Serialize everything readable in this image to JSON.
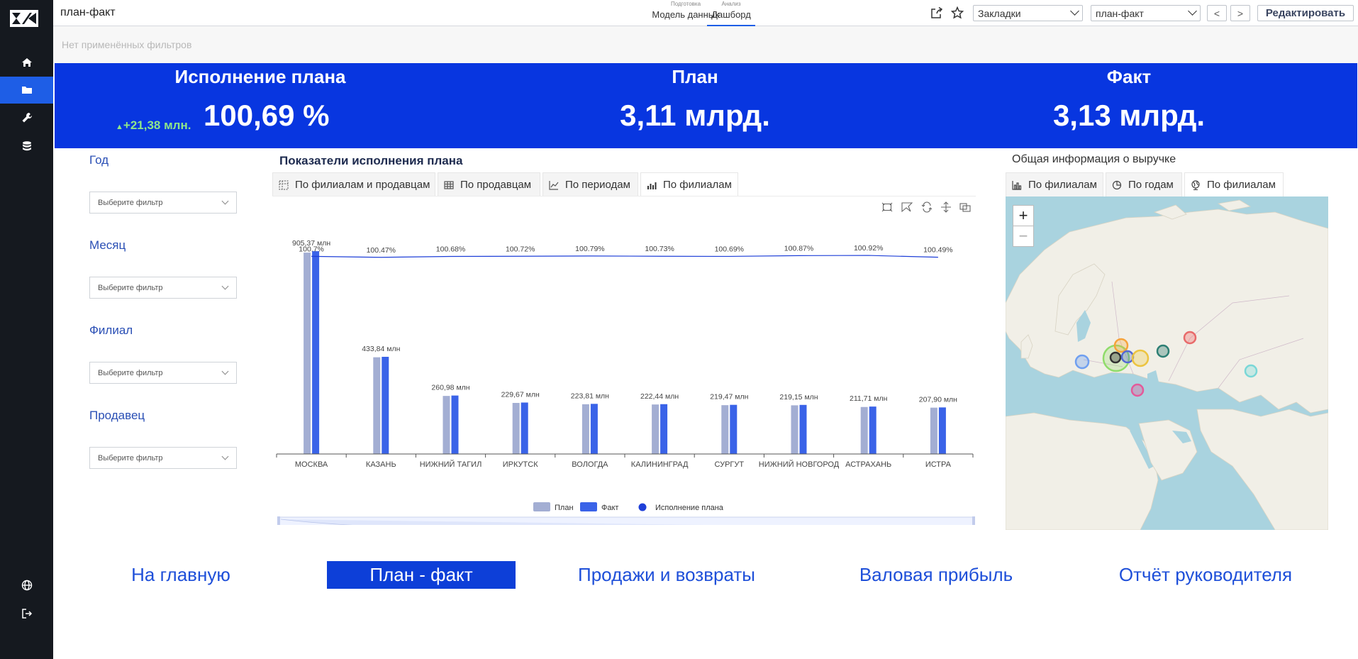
{
  "app": {
    "page_title": "план-факт"
  },
  "mode_tabs": [
    {
      "small": "Подготовка",
      "label": "Модель данных"
    },
    {
      "small": "Анализ",
      "label": "Дашборд"
    }
  ],
  "toolbar": {
    "bookmarks_value": "Закладки",
    "report_value": "план-факт",
    "prev_label": "<",
    "next_label": ">",
    "edit_label": "Редактировать"
  },
  "filter_bar": {
    "text": "Нет применённых фильтров"
  },
  "kpi": {
    "execution": {
      "title": "Исполнение плана",
      "delta": "+21,38 млн.",
      "value": "100,69 %"
    },
    "plan": {
      "title": "План",
      "value": "3,11 млрд."
    },
    "fact": {
      "title": "Факт",
      "value": "3,13 млрд."
    }
  },
  "filters": [
    {
      "label": "Год",
      "placeholder": "Выберите фильтр"
    },
    {
      "label": "Месяц",
      "placeholder": "Выберите фильтр"
    },
    {
      "label": "Филиал",
      "placeholder": "Выберите фильтр"
    },
    {
      "label": "Продавец",
      "placeholder": "Выберите фильтр"
    }
  ],
  "chart_panel": {
    "title": "Показатели исполнения плана",
    "tabs": [
      "По филиалам и продавцам",
      "По продавцам",
      "По периодам",
      "По филиалам"
    ],
    "active_tab": 3
  },
  "chart_data": {
    "type": "bar",
    "categories": [
      "МОСКВА",
      "КАЗАНЬ",
      "НИЖНИЙ ТАГИЛ",
      "ИРКУТСК",
      "ВОЛОГДА",
      "КАЛИНИНГРАД",
      "СУРГУТ",
      "НИЖНИЙ НОВГОРОД",
      "АСТРАХАНЬ",
      "ИСТРА"
    ],
    "series": [
      {
        "name": "План",
        "values": [
          899.0,
          431.8,
          259.2,
          228.0,
          222.1,
          221.0,
          218.0,
          217.3,
          209.8,
          206.9
        ],
        "color": "#a3aed3"
      },
      {
        "name": "Факт",
        "values": [
          905.37,
          433.84,
          260.98,
          229.67,
          223.81,
          222.44,
          219.47,
          219.15,
          211.71,
          207.9
        ],
        "color": "#3a63e8"
      }
    ],
    "bar_labels": [
      "905,37 млн",
      "433,84 млн",
      "260,98 млн",
      "229,67 млн",
      "223,81 млн",
      "222,44 млн",
      "219,47 млн",
      "219,15 млн",
      "211,71 млн",
      "207,90 млн"
    ],
    "line_series": {
      "name": "Исполнение плана",
      "values": [
        100.71,
        100.47,
        100.68,
        100.72,
        100.79,
        100.73,
        100.69,
        100.87,
        100.92,
        100.49
      ],
      "labels": [
        "100.7%",
        "100.47%",
        "100.68%",
        "100.72%",
        "100.79%",
        "100.73%",
        "100.69%",
        "100.87%",
        "100.92%",
        "100.49%"
      ],
      "color": "#1e3fd8"
    },
    "ylim": [
      0,
      950
    ],
    "legend": "bottom-center",
    "grid": false
  },
  "map_panel": {
    "title": "Общая информация о выручке",
    "tabs": [
      "По филиалам",
      "По годам",
      "По филиалам"
    ],
    "active_tab": 2,
    "zoom_in": "+",
    "zoom_out": "−"
  },
  "bottom_nav": [
    {
      "label": "На главную"
    },
    {
      "label": "План - факт"
    },
    {
      "label": "Продажи и возвраты"
    },
    {
      "label": "Валовая прибыль"
    },
    {
      "label": "Отчёт руководителя"
    }
  ]
}
